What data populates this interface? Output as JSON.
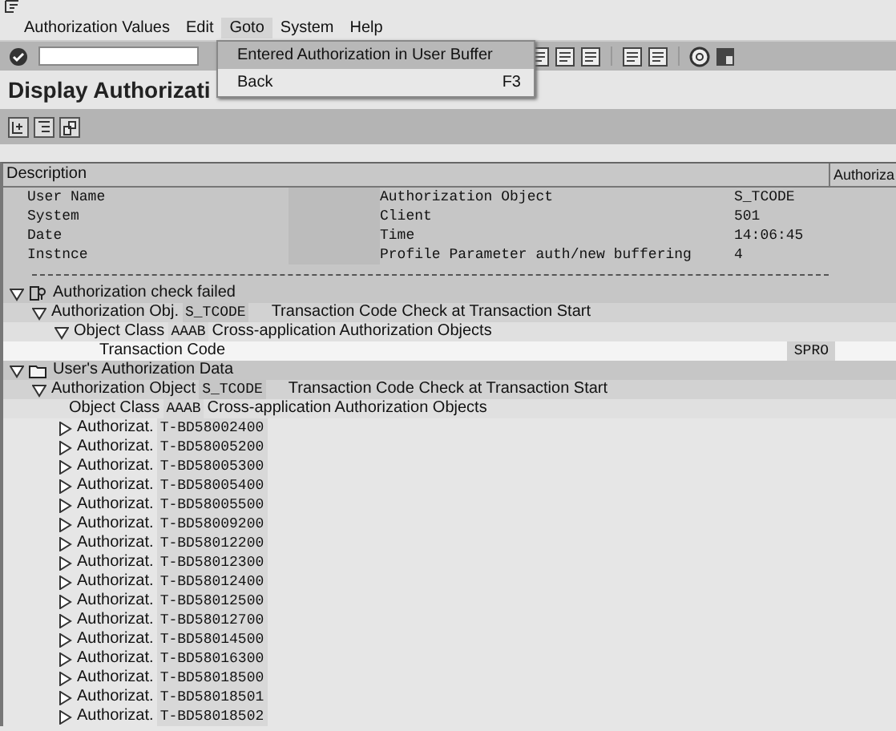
{
  "menu": [
    {
      "label": "Authorization Values",
      "selected": false
    },
    {
      "label": "Edit",
      "selected": false
    },
    {
      "label": "Goto",
      "selected": true
    },
    {
      "label": "System",
      "selected": false
    },
    {
      "label": "Help",
      "selected": false
    }
  ],
  "dropdown": [
    {
      "label": "Entered Authorization in User Buffer",
      "selected": true
    },
    {
      "label": "Back",
      "shortcut": "F3",
      "selected": false
    }
  ],
  "title": "Display Authorizati",
  "columns": [
    "Description",
    "Authoriza"
  ],
  "info": [
    {
      "label": "User Name",
      "label2": "Authorization Object",
      "value2": "S_TCODE"
    },
    {
      "label": "System",
      "label2": "Client",
      "value2": "501"
    },
    {
      "label": "Date",
      "label2": "Time",
      "value2": "14:06:45"
    },
    {
      "label": "Instnce",
      "label2": "Profile Parameter auth/new buffering",
      "value2": "4"
    }
  ],
  "tree": [
    {
      "kind": "check-group",
      "label": "Authorization check failed",
      "expanded": true,
      "children": [
        {
          "kind": "object",
          "label": "Authorization Obj.",
          "code": "S_TCODE",
          "text": "Transaction Code Check at Transaction Start",
          "expanded": true,
          "children": [
            {
              "kind": "class",
              "label": "Object Class",
              "code": "AAAB",
              "text": "Cross-application Authorization Objects",
              "expanded": true,
              "children": [
                {
                  "kind": "field",
                  "label": "Transaction Code",
                  "value": "SPRO"
                }
              ]
            }
          ]
        }
      ]
    },
    {
      "kind": "data-group",
      "label": "User's Authorization Data",
      "expanded": true,
      "children": [
        {
          "kind": "object",
          "label": "Authorization Object",
          "code": "S_TCODE",
          "text": "Transaction Code Check at Transaction Start",
          "expanded": true,
          "children": [
            {
              "kind": "class",
              "label": "Object Class",
              "code": "AAAB",
              "text": "Cross-application Authorization Objects"
            },
            {
              "kind": "auth",
              "label": "Authorizat.",
              "code": "T-BD58002400",
              "expanded": false
            },
            {
              "kind": "auth",
              "label": "Authorizat.",
              "code": "T-BD58005200",
              "expanded": false
            },
            {
              "kind": "auth",
              "label": "Authorizat.",
              "code": "T-BD58005300",
              "expanded": false
            },
            {
              "kind": "auth",
              "label": "Authorizat.",
              "code": "T-BD58005400",
              "expanded": false
            },
            {
              "kind": "auth",
              "label": "Authorizat.",
              "code": "T-BD58005500",
              "expanded": false
            },
            {
              "kind": "auth",
              "label": "Authorizat.",
              "code": "T-BD58009200",
              "expanded": false
            },
            {
              "kind": "auth",
              "label": "Authorizat.",
              "code": "T-BD58012200",
              "expanded": false
            },
            {
              "kind": "auth",
              "label": "Authorizat.",
              "code": "T-BD58012300",
              "expanded": false
            },
            {
              "kind": "auth",
              "label": "Authorizat.",
              "code": "T-BD58012400",
              "expanded": false
            },
            {
              "kind": "auth",
              "label": "Authorizat.",
              "code": "T-BD58012500",
              "expanded": false
            },
            {
              "kind": "auth",
              "label": "Authorizat.",
              "code": "T-BD58012700",
              "expanded": false
            },
            {
              "kind": "auth",
              "label": "Authorizat.",
              "code": "T-BD58014500",
              "expanded": false
            },
            {
              "kind": "auth",
              "label": "Authorizat.",
              "code": "T-BD58016300",
              "expanded": false
            },
            {
              "kind": "auth",
              "label": "Authorizat.",
              "code": "T-BD58018500",
              "expanded": false
            },
            {
              "kind": "auth",
              "label": "Authorizat.",
              "code": "T-BD58018501",
              "expanded": false
            },
            {
              "kind": "auth",
              "label": "Authorizat.",
              "code": "T-BD58018502",
              "expanded": false
            }
          ]
        }
      ]
    }
  ]
}
